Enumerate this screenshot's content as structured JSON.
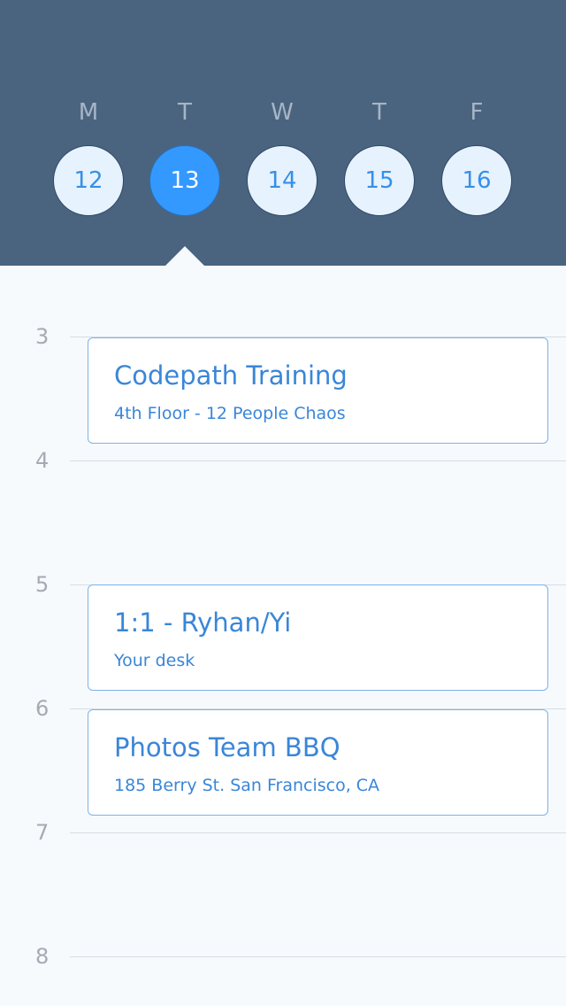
{
  "week": {
    "days": [
      {
        "letter": "M",
        "date": "12",
        "selected": false
      },
      {
        "letter": "T",
        "date": "13",
        "selected": true
      },
      {
        "letter": "W",
        "date": "14",
        "selected": false
      },
      {
        "letter": "T",
        "date": "15",
        "selected": false
      },
      {
        "letter": "F",
        "date": "16",
        "selected": false
      }
    ]
  },
  "timeline": {
    "hours": [
      "3",
      "4",
      "5",
      "6",
      "7",
      "8"
    ]
  },
  "events": [
    {
      "title": "Codepath Training",
      "subtitle": "4th Floor - 12 People Chaos",
      "start": "3",
      "end": "4"
    },
    {
      "title": "1:1 - Ryhan/Yi",
      "subtitle": "Your desk",
      "start": "5",
      "end": "6"
    },
    {
      "title": "Photos Team BBQ",
      "subtitle": "185 Berry St. San Francisco, CA",
      "start": "6",
      "end": "7"
    }
  ],
  "colors": {
    "header_bg": "#4a6480",
    "selected_day": "#3399ff",
    "accent": "#3a86d8",
    "page_bg": "#f6fafd"
  }
}
